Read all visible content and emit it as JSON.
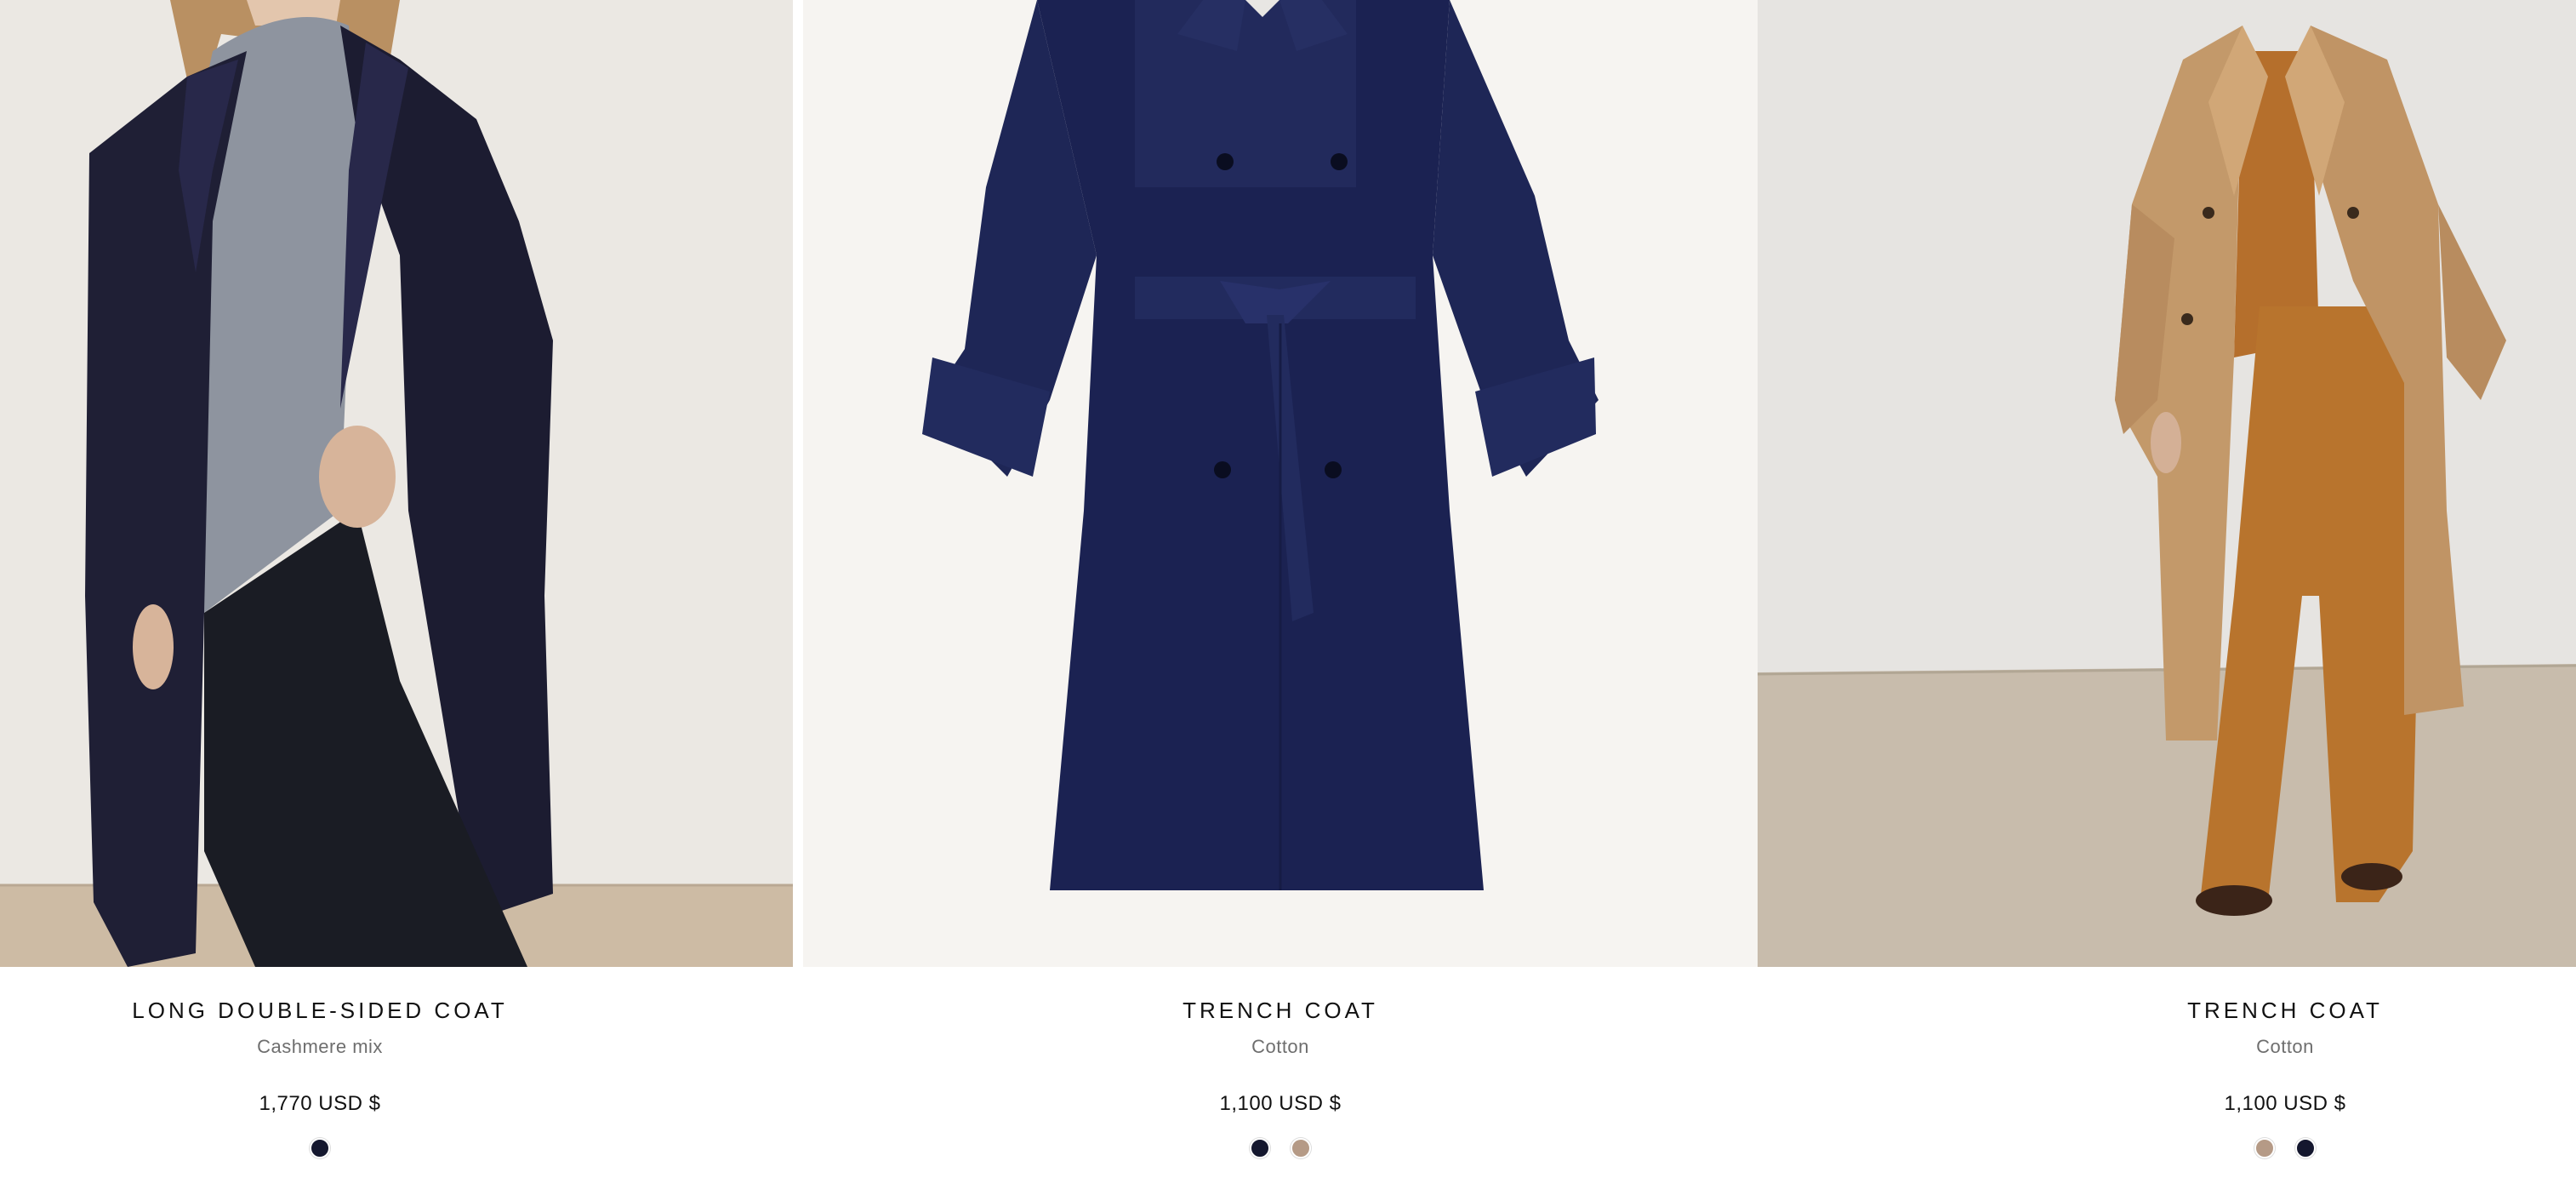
{
  "products": [
    {
      "name": "LONG DOUBLE-SIDED COAT",
      "material": "Cashmere mix",
      "price": "1,770 USD $",
      "swatches": [
        {
          "name": "navy",
          "color": "#14172e"
        }
      ]
    },
    {
      "name": "TRENCH COAT",
      "material": "Cotton",
      "price": "1,100 USD $",
      "swatches": [
        {
          "name": "navy",
          "color": "#14172e"
        },
        {
          "name": "beige",
          "color": "#b59a86"
        }
      ]
    },
    {
      "name": "TRENCH COAT",
      "material": "Cotton",
      "price": "1,100 USD $",
      "swatches": [
        {
          "name": "beige",
          "color": "#b59a86"
        },
        {
          "name": "navy",
          "color": "#14172e"
        }
      ]
    }
  ],
  "colors": {
    "navy_coat": "#1b2250",
    "dark_coat": "#1d1d33",
    "beige_coat": "#c49a6c",
    "rust_pants": "#b8742d",
    "background_wall": "#ece9e4",
    "floor": "#cbbba6"
  }
}
